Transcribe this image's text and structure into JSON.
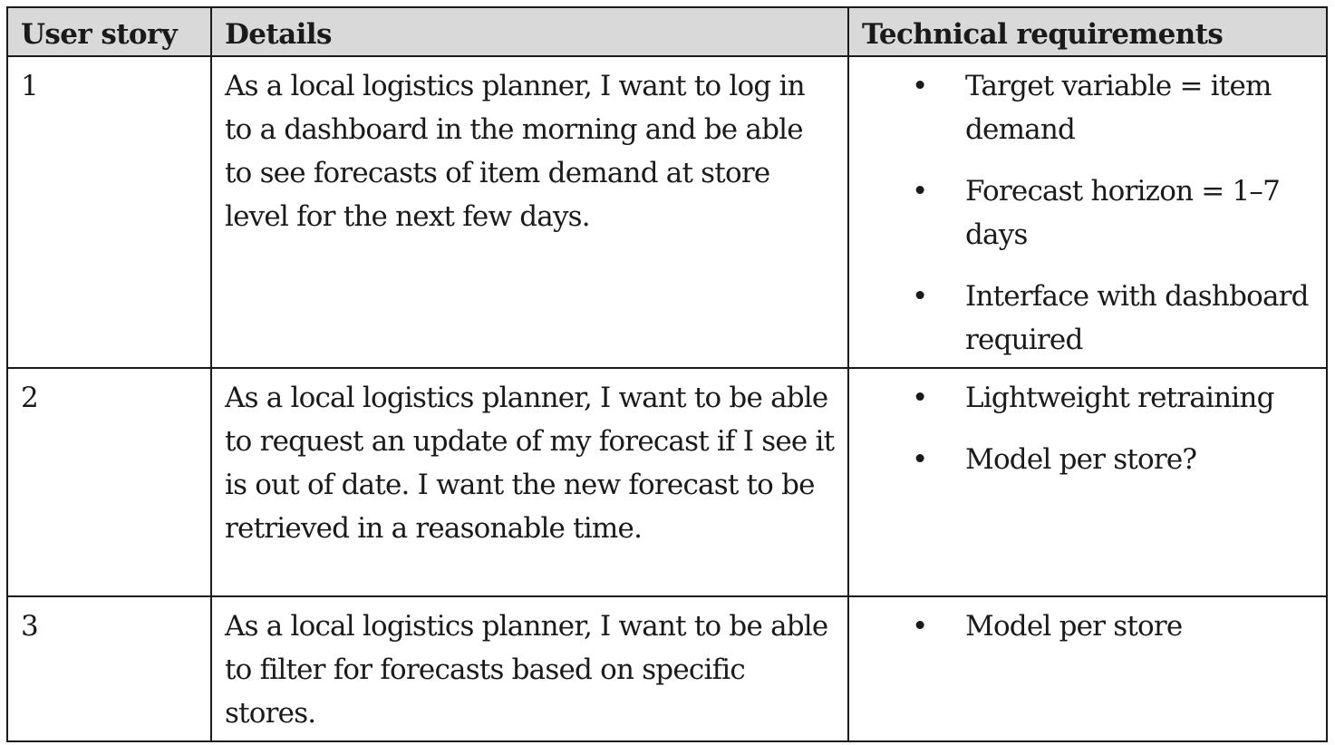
{
  "table": {
    "headers": [
      "User story",
      "Details",
      "Technical requirements"
    ],
    "rows": [
      {
        "story": "1",
        "details": "As a local logistics planner, I want to log in to a dashboard in the morning and be able to see forecasts of item demand at store level for the next few days.",
        "requirements": [
          "Target variable = item demand",
          "Forecast horizon = 1–7 days",
          "Interface with dashboard required"
        ]
      },
      {
        "story": "2",
        "details": "As a local logistics planner, I want to be able to request an update of my forecast if I see it is out of date. I want the new forecast to be retrieved in a reasonable time.",
        "requirements": [
          "Lightweight retraining",
          "Model per store?"
        ]
      },
      {
        "story": "3",
        "details": "As a local logistics planner, I want to be able to filter for forecasts based on specific stores.",
        "requirements": [
          "Model per store"
        ]
      }
    ],
    "bullet_glyph": "•"
  }
}
